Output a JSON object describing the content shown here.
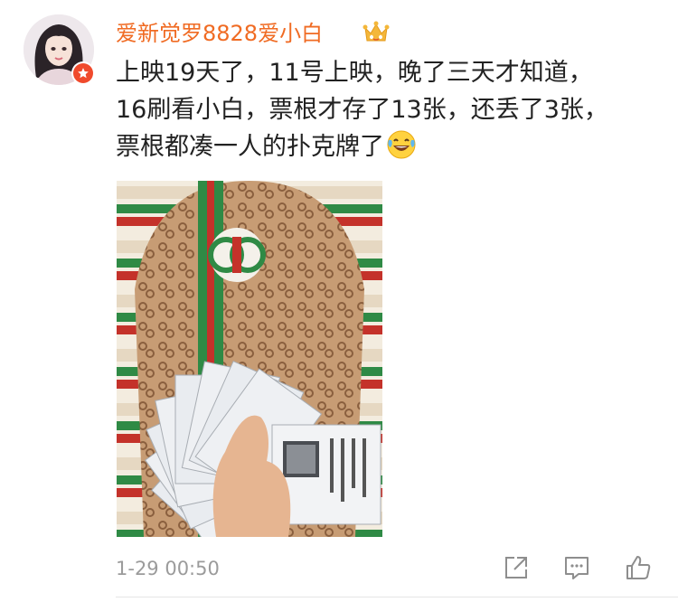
{
  "post": {
    "username": "爱新觉罗8828爱小白",
    "content_lines": [
      "上映19天了，11号上映，晚了三天才知道，",
      "16刷看小白，票根才存了13张，还丢了3张，",
      "票根都凑一人的扑克牌了"
    ],
    "timestamp": "1-29 00:50"
  },
  "icons": {
    "crown": "crown-icon",
    "verified": "star-badge-icon",
    "emoji": "laughing-tears-emoji-icon",
    "share": "share-icon",
    "comment": "comment-icon",
    "like": "thumbs-up-icon"
  },
  "colors": {
    "username": "#f06b23",
    "text": "#222222",
    "timestamp": "#9b9b9b",
    "badge": "#f04a2c",
    "crown": "#f4b73a"
  }
}
